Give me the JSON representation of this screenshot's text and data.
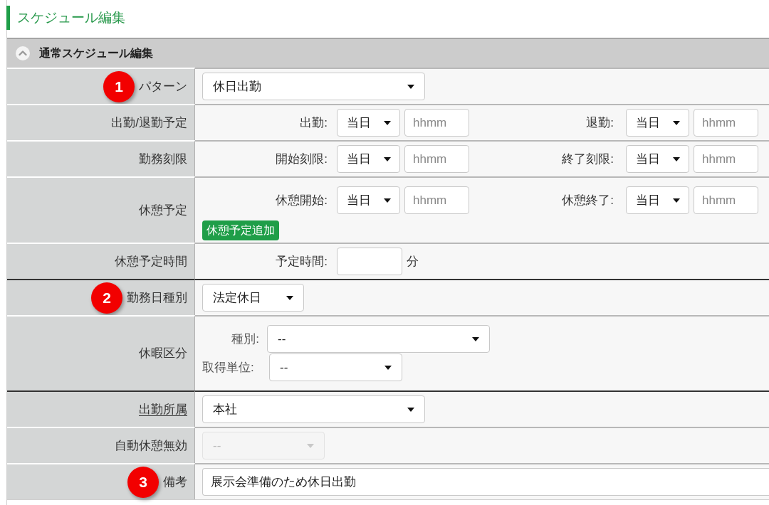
{
  "page_title": "スケジュール編集",
  "section": {
    "title": "通常スケジュール編集",
    "expanded": true,
    "groups": [
      {
        "rows": [
          {
            "kind": "select",
            "label": "パターン",
            "callout": "1",
            "link": false,
            "value": "休日出勤",
            "disabled": false
          },
          {
            "kind": "time_pair",
            "label": "出勤/退勤予定",
            "link": false,
            "pairs": [
              {
                "label": "出勤:",
                "day": "当日",
                "placeholder": "hhmm"
              },
              {
                "label": "退勤:",
                "day": "当日",
                "placeholder": "hhmm"
              }
            ]
          },
          {
            "kind": "time_pair",
            "label": "勤務刻限",
            "link": false,
            "pairs": [
              {
                "label": "開始刻限:",
                "day": "当日",
                "placeholder": "hhmm"
              },
              {
                "label": "終了刻限:",
                "day": "当日",
                "placeholder": "hhmm"
              }
            ]
          },
          {
            "kind": "time_pair",
            "label": "休憩予定",
            "link": false,
            "pairs": [
              {
                "label": "休憩開始:",
                "day": "当日",
                "placeholder": "hhmm"
              },
              {
                "label": "休憩終了:",
                "day": "当日",
                "placeholder": "hhmm"
              }
            ],
            "button": "休憩予定追加"
          },
          {
            "kind": "duration",
            "label": "休憩予定時間",
            "link": false,
            "field_label": "予定時間:",
            "unit": "分"
          }
        ]
      },
      {
        "rows": [
          {
            "kind": "select",
            "label": "勤務日種別",
            "callout": "2",
            "link": false,
            "value": "法定休日",
            "disabled": false
          },
          {
            "kind": "selects",
            "label": "休暇区分",
            "link": false,
            "selects": [
              {
                "label": "種別:",
                "value": "--"
              },
              {
                "label": "取得単位:",
                "value": "--"
              }
            ]
          }
        ]
      },
      {
        "rows": [
          {
            "kind": "select",
            "label": "出勤所属",
            "link": true,
            "value": "本社",
            "disabled": false
          },
          {
            "kind": "select",
            "label": "自動休憩無効",
            "link": false,
            "value": "--",
            "disabled": true
          },
          {
            "kind": "text",
            "label": "備考",
            "callout": "3",
            "link": false,
            "value": "展示会準備のため休日出勤"
          }
        ]
      }
    ]
  }
}
